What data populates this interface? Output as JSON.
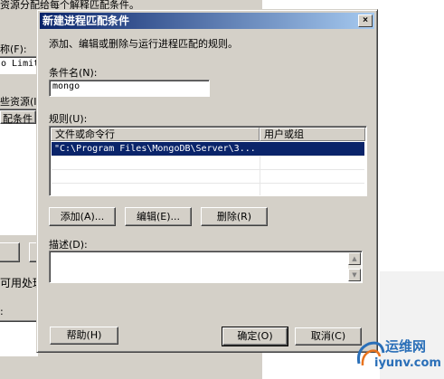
{
  "background": {
    "top_text": "资源分配给每个解释匹配条件。",
    "name_label": "称(F):",
    "name_value": "o Limit",
    "resource_label": "些资源(I)",
    "criteria_label": "配条件",
    "usable_label": "可用处理",
    "colon_label": ":"
  },
  "dialog": {
    "title": "新建进程匹配条件",
    "close_glyph": "×",
    "description": "添加、编辑或删除与运行进程匹配的规则。",
    "condition_name_label": "条件名(N):",
    "condition_name_value": "mongo",
    "rules_label": "规则(U):",
    "rules_columns": [
      "文件或命令行",
      "用户或组"
    ],
    "rules_rows": [
      {
        "file": "\"C:\\Program Files\\MongoDB\\Server\\3...",
        "user": ""
      }
    ],
    "add_button": "添加(A)...",
    "edit_button": "编辑(E)...",
    "delete_button": "删除(R)",
    "description_label": "描述(D):",
    "description_value": "",
    "help_button": "帮助(H)",
    "ok_button": "确定(O)",
    "cancel_button": "取消(C)"
  },
  "watermark": {
    "cn": "运维网",
    "url": "iyunv.com"
  },
  "colors": {
    "title_start": "#0a246a",
    "title_end": "#a6caf0",
    "selection": "#0a246a",
    "face": "#d4d0c8",
    "watermark": "#2a6fb8"
  }
}
